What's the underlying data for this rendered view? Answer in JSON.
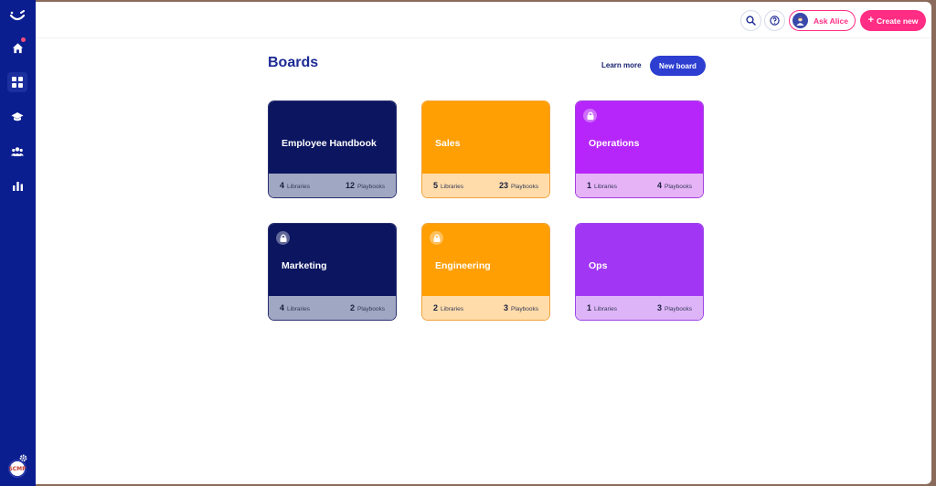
{
  "sidebar": {
    "items": [
      {
        "name": "home",
        "icon": "home-icon",
        "active": false
      },
      {
        "name": "boards",
        "icon": "grid-icon",
        "active": true
      },
      {
        "name": "learning",
        "icon": "graduation-cap-icon",
        "active": false
      },
      {
        "name": "team",
        "icon": "users-icon",
        "active": false
      },
      {
        "name": "analytics",
        "icon": "bar-chart-icon",
        "active": false
      }
    ],
    "user_avatar_text": "SCMP"
  },
  "topbar": {
    "ask_label": "Ask Alice",
    "create_label": "Create new",
    "create_icon": "+"
  },
  "page": {
    "title": "Boards",
    "learn_more": "Learn more",
    "new_board": "New board"
  },
  "boards": [
    {
      "title": "Employee Handbook",
      "libraries": "4",
      "playbooks": "12",
      "locked": false,
      "theme": "navy"
    },
    {
      "title": "Sales",
      "libraries": "5",
      "playbooks": "23",
      "locked": false,
      "theme": "orange"
    },
    {
      "title": "Operations",
      "libraries": "1",
      "playbooks": "4",
      "locked": true,
      "theme": "purple"
    },
    {
      "title": "Marketing",
      "libraries": "4",
      "playbooks": "2",
      "locked": true,
      "theme": "navy"
    },
    {
      "title": "Engineering",
      "libraries": "2",
      "playbooks": "3",
      "locked": true,
      "theme": "orange"
    },
    {
      "title": "Ops",
      "libraries": "1",
      "playbooks": "3",
      "locked": false,
      "theme": "violet"
    }
  ],
  "labels": {
    "libraries": "Libraries",
    "playbooks": "Playbooks"
  },
  "colors": {
    "sidebar": "#0b1e8f",
    "accent_pink": "#ff2d84",
    "primary_blue": "#2d3ed1",
    "navy_card": "#0b1560",
    "orange_card": "#ff9f04",
    "purple_card": "#b626fa"
  }
}
